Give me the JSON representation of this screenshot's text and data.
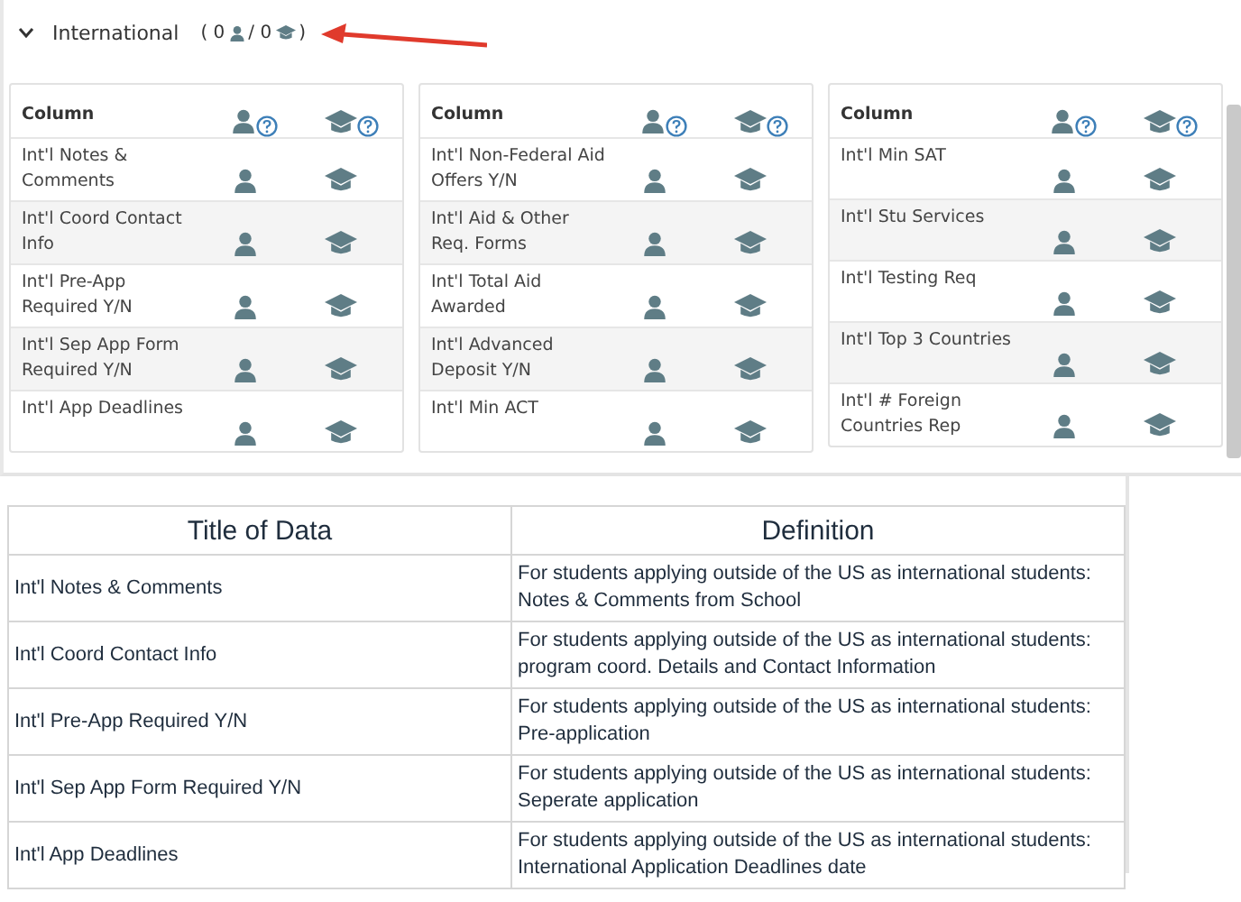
{
  "section": {
    "title": "International",
    "expanded": true,
    "summary": {
      "open": "( 0",
      "middle": "/ 0",
      "close": ")"
    }
  },
  "panels": [
    {
      "header": "Column",
      "rows": [
        "Int'l Notes & Comments",
        "Int'l Coord Contact Info",
        "Int'l Pre-App Required Y/N",
        "Int'l Sep App Form Required Y/N",
        "Int'l App Deadlines"
      ]
    },
    {
      "header": "Column",
      "rows": [
        "Int'l Non-Federal Aid Offers Y/N",
        "Int'l Aid & Other Req. Forms",
        "Int'l Total Aid Awarded",
        "Int'l Advanced Deposit Y/N",
        "Int'l Min ACT"
      ]
    },
    {
      "header": "Column",
      "rows": [
        "Int'l Min SAT",
        "Int'l Stu Services",
        "Int'l Testing Req",
        "Int'l Top 3 Countries",
        "Int'l # Foreign Countries Rep"
      ]
    }
  ],
  "table": {
    "columns": [
      "Title of Data",
      "Definition"
    ],
    "rows": [
      [
        "Int'l Notes & Comments",
        "For students applying outside of the US as international students: Notes & Comments from School"
      ],
      [
        "Int'l Coord Contact Info",
        "For students applying outside of the US as international students: program coord. Details and Contact Information"
      ],
      [
        "Int'l Pre-App Required Y/N",
        "For students applying outside of the US as international students: Pre-application"
      ],
      [
        "Int'l Sep App Form Required Y/N",
        "For students applying outside of the US as international students: Seperate application"
      ],
      [
        "Int'l App Deadlines",
        "For students applying outside of the US as international students: International Application Deadlines date"
      ]
    ]
  }
}
